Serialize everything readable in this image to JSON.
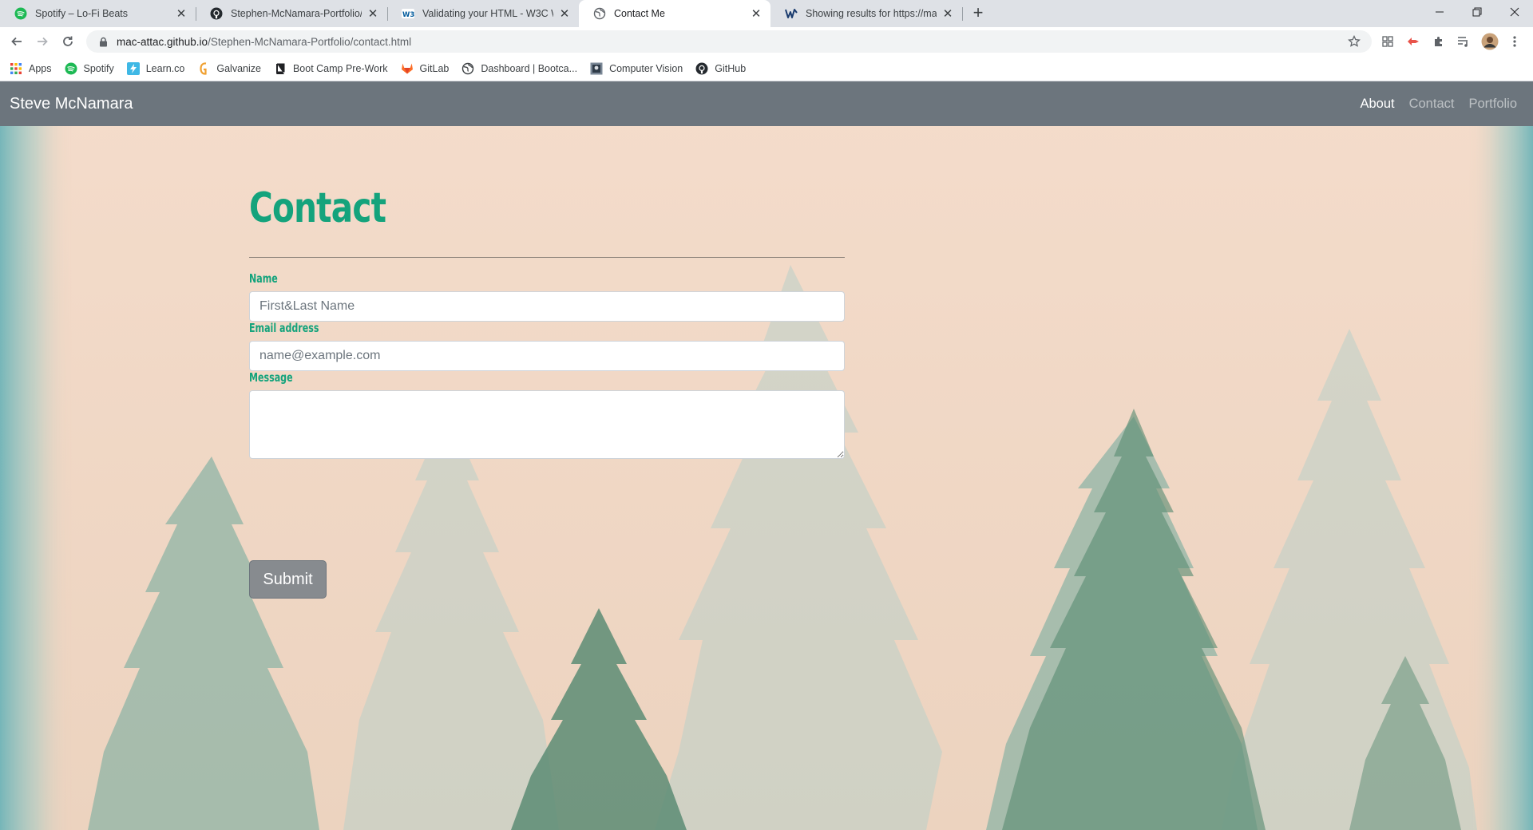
{
  "browser": {
    "tabs": [
      {
        "title": "Spotify – Lo-Fi Beats",
        "icon": "spotify-icon",
        "active": false
      },
      {
        "title": "Stephen-McNamara-Portfolio/RE",
        "icon": "github-icon",
        "active": false
      },
      {
        "title": "Validating your HTML - W3C Wik",
        "icon": "w3c-icon",
        "active": false
      },
      {
        "title": "Contact Me",
        "icon": "globe-icon",
        "active": true
      },
      {
        "title": "Showing results for https://mac-",
        "icon": "wave-icon",
        "active": false
      }
    ],
    "url": {
      "host": "mac-attac.github.io",
      "path": "/Stephen-McNamara-Portfolio/contact.html"
    },
    "bookmarks": [
      {
        "label": "Apps",
        "icon": "apps-grid-icon"
      },
      {
        "label": "Spotify",
        "icon": "spotify-icon"
      },
      {
        "label": "Learn.co",
        "icon": "learnco-icon"
      },
      {
        "label": "Galvanize",
        "icon": "galvanize-icon"
      },
      {
        "label": "Boot Camp Pre-Work",
        "icon": "book-icon"
      },
      {
        "label": "GitLab",
        "icon": "gitlab-icon"
      },
      {
        "label": "Dashboard | Bootca...",
        "icon": "globe-icon"
      },
      {
        "label": "Computer Vision",
        "icon": "image-icon"
      },
      {
        "label": "GitHub",
        "icon": "github-icon"
      }
    ]
  },
  "site": {
    "brand": "Steve McNamara",
    "nav": [
      {
        "label": "About",
        "active": true
      },
      {
        "label": "Contact",
        "active": false
      },
      {
        "label": "Portfolio",
        "active": false
      }
    ]
  },
  "form": {
    "heading": "Contact",
    "name_label": "Name",
    "name_placeholder": "First&Last Name",
    "email_label": "Email address",
    "email_placeholder": "name@example.com",
    "message_label": "Message",
    "message_placeholder": "",
    "submit_label": "Submit"
  },
  "colors": {
    "accent": "#14a37c",
    "navbar": "#6c757d",
    "page_bg": "#f0d6c3",
    "tree": "#5c8c74"
  }
}
